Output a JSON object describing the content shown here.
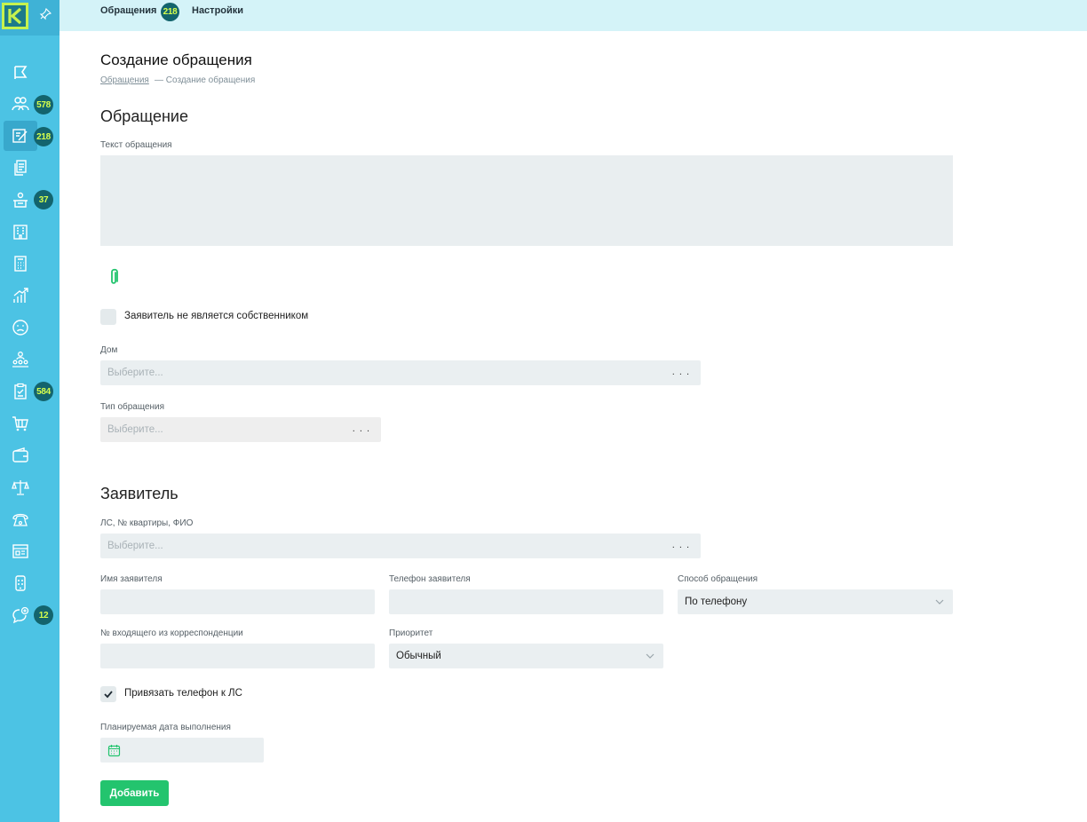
{
  "sidebar": {
    "logo_letter": "K",
    "badges": [
      "578",
      "218",
      "37",
      "584",
      "12"
    ]
  },
  "topbar": {
    "tab_requests": "Обращения",
    "tab_requests_count": "218",
    "tab_settings": "Настройки"
  },
  "page": {
    "title": "Создание обращения",
    "breadcrumb_link": "Обращения",
    "breadcrumb_current": "— Создание обращения"
  },
  "request": {
    "section_title": "Обращение",
    "text_label": "Текст обращения",
    "not_owner_label": "Заявитель не является собственником",
    "house_label": "Дом",
    "house_placeholder": "Выберите...",
    "type_label": "Тип обращения",
    "type_placeholder": "Выберите...",
    "more": ". . ."
  },
  "applicant": {
    "section_title": "Заявитель",
    "account_label": "ЛС, № квартиры, ФИО",
    "account_placeholder": "Выберите...",
    "name_label": "Имя заявителя",
    "phone_label": "Телефон заявителя",
    "method_label": "Способ обращения",
    "method_value": "По телефону",
    "incoming_label": "№ входящего из корреспонденции",
    "priority_label": "Приоритет",
    "priority_value": "Обычный",
    "bind_phone_label": "Привязать телефон к ЛС",
    "bind_phone_checked": true,
    "date_label": "Планируемая дата выполнения"
  },
  "actions": {
    "add_label": "Добавить"
  },
  "colors": {
    "sidebar": "#4cc3e4",
    "topbar": "#d4f3f8",
    "badge": "#13646d",
    "badge_text": "#d6ff4d",
    "primary_button": "#23c46e"
  }
}
